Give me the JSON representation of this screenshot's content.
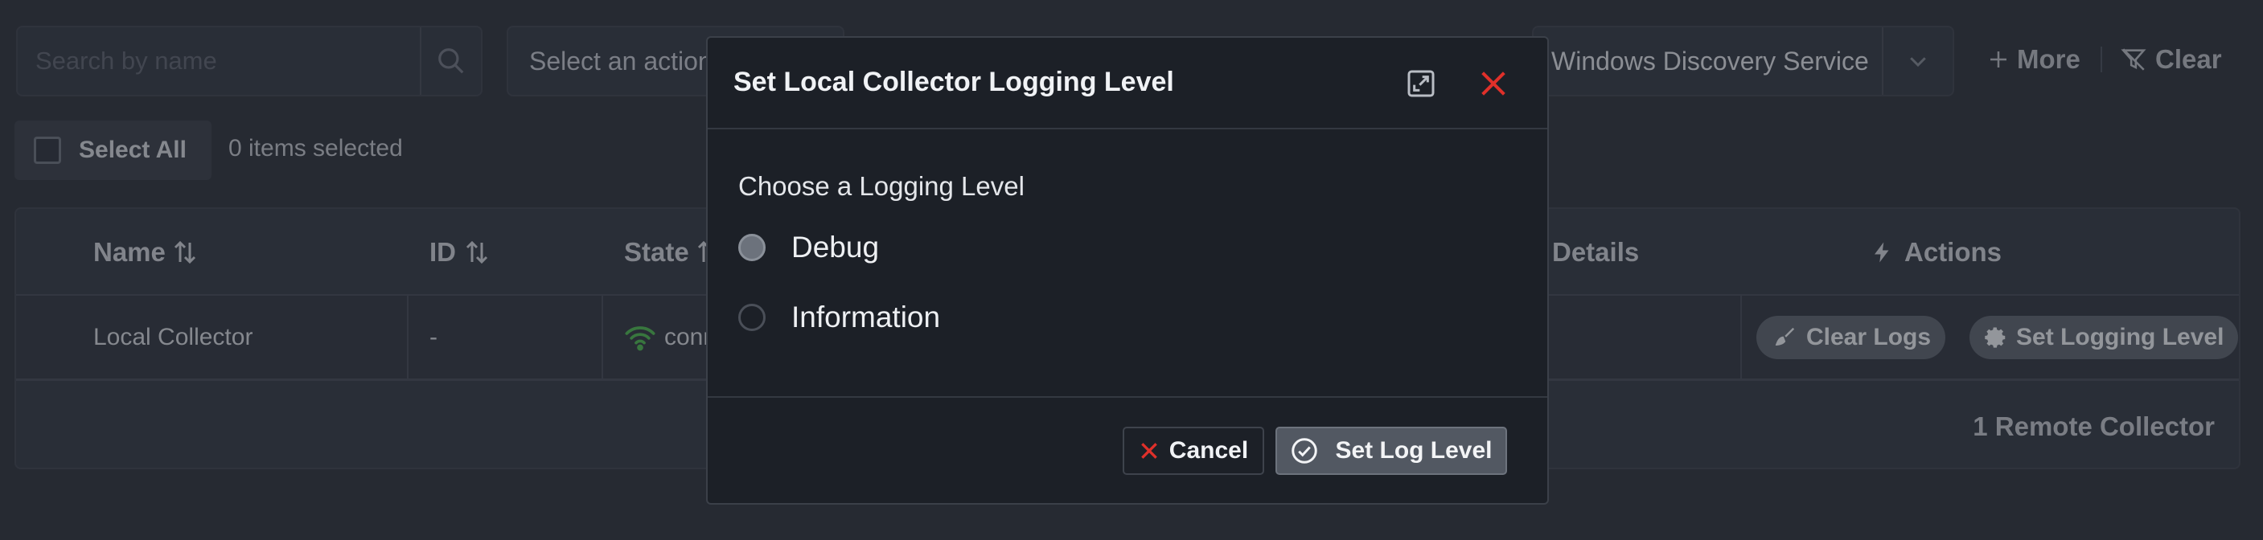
{
  "toolbar": {
    "search_placeholder": "Search by name",
    "action_select_value": "Select an action",
    "service_select_value": "Windows Discovery Service",
    "more_label": "More",
    "clear_label": "Clear"
  },
  "selection": {
    "select_all_label": "Select All",
    "items_selected_text": "0 items selected"
  },
  "table": {
    "headers": {
      "name": "Name",
      "id": "ID",
      "state": "State",
      "details": "Details",
      "actions": "Actions"
    },
    "rows": [
      {
        "name": "Local Collector",
        "id": "-",
        "state": "connected",
        "details": "",
        "actions": [
          "Clear Logs",
          "Set Logging Level"
        ]
      }
    ],
    "footer_text": "1 Remote Collector"
  },
  "modal": {
    "title": "Set Local Collector Logging Level",
    "question": "Choose a Logging Level",
    "options": [
      {
        "label": "Debug",
        "selected": true
      },
      {
        "label": "Information",
        "selected": false
      }
    ],
    "cancel_label": "Cancel",
    "submit_label": "Set Log Level"
  },
  "colors": {
    "background": "#2f343d",
    "modal_background": "#1c2027",
    "close_red": "#e0302a",
    "connected_green": "#4caf50"
  },
  "icons": {
    "search": "search-icon",
    "chevron": "chevron-down-icon",
    "plus": "plus-icon",
    "filter_clear": "filter-clear-icon",
    "sort": "sort-icon",
    "wifi": "wifi-icon",
    "bolt": "bolt-icon",
    "broom": "broom-icon",
    "gear": "gear-icon",
    "expand": "expand-icon",
    "close": "close-icon",
    "check_circle": "check-circle-icon"
  }
}
